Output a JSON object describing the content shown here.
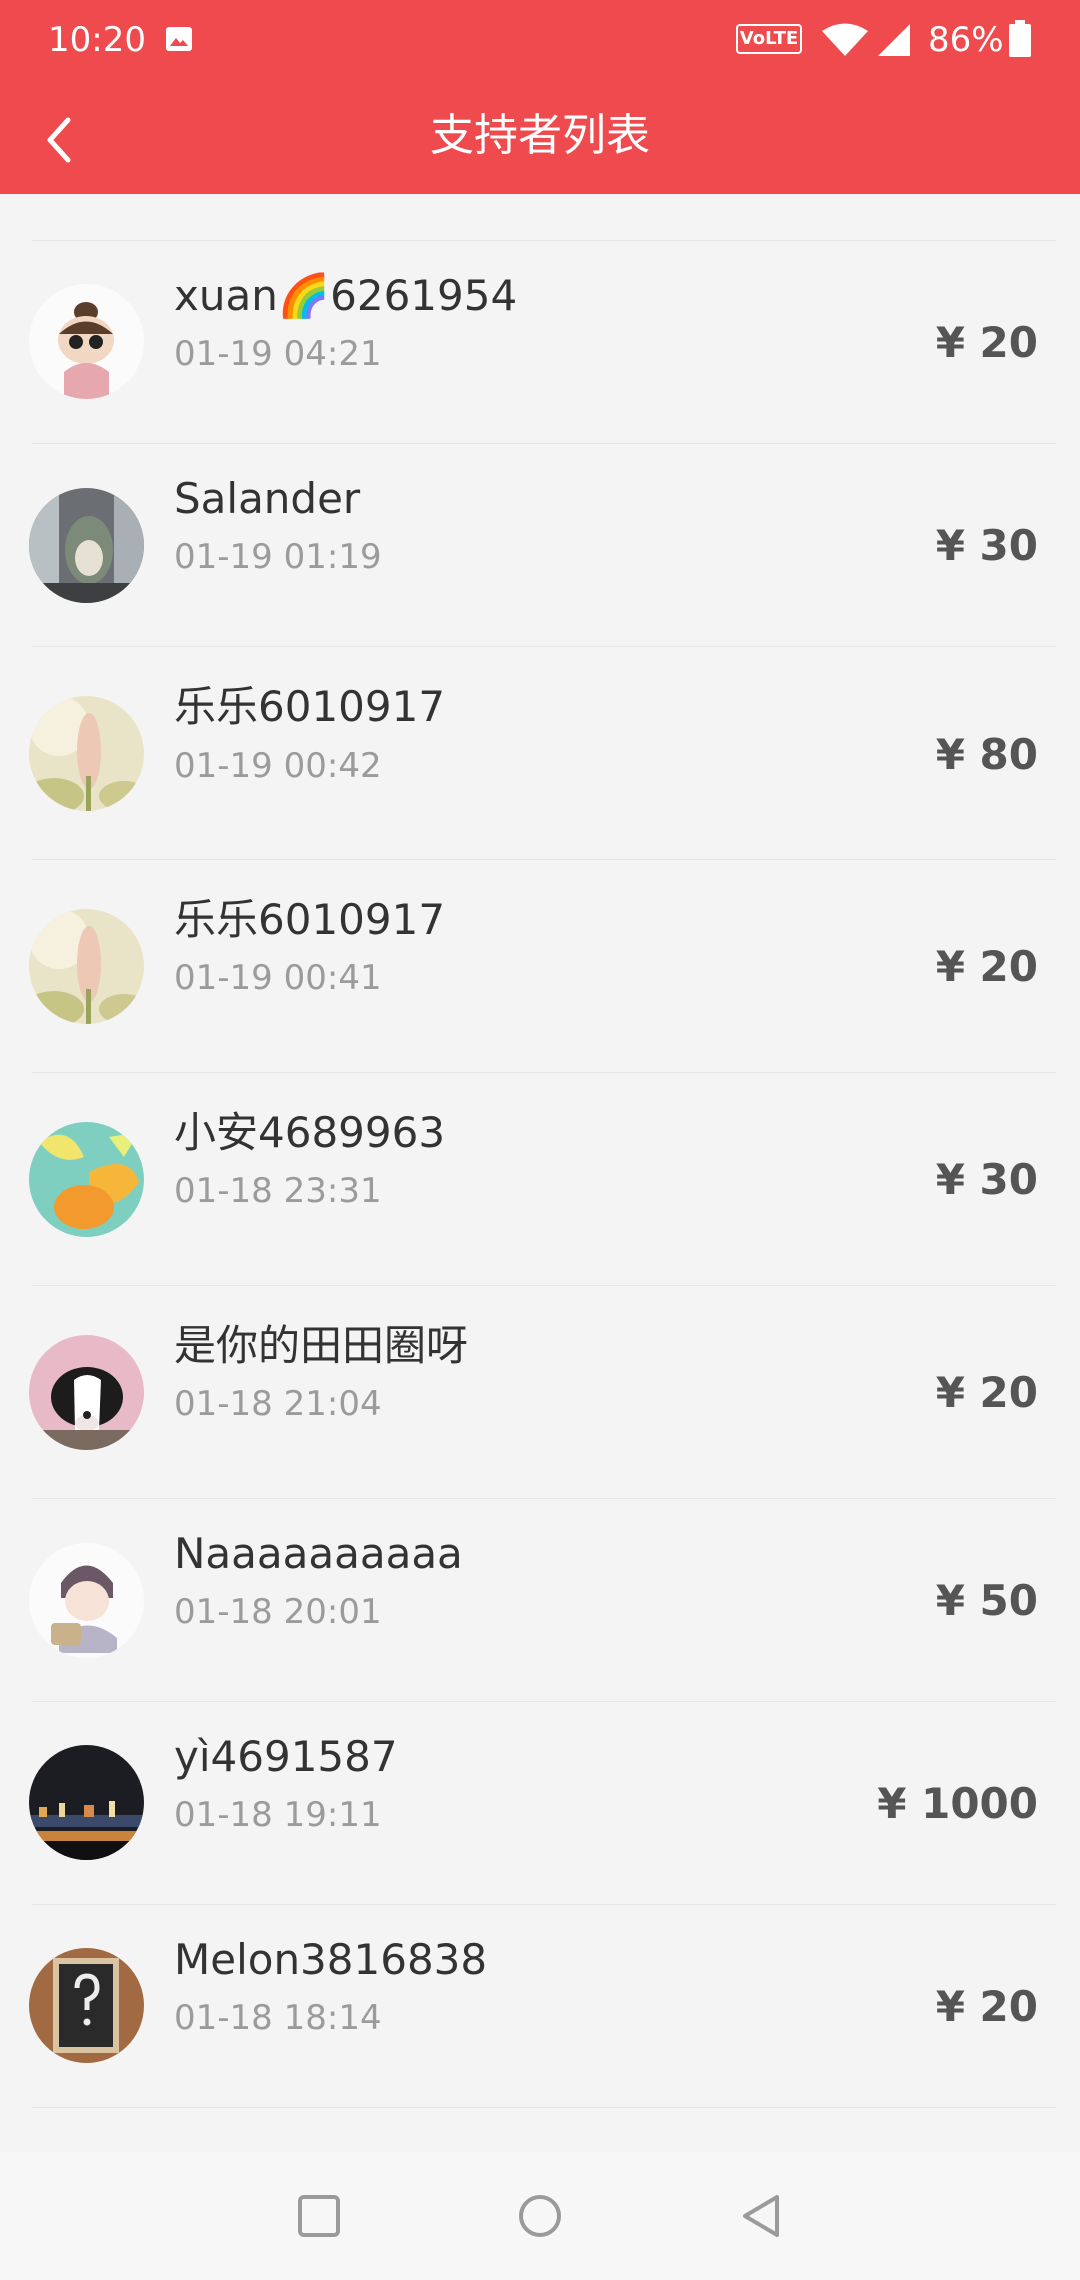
{
  "status_bar": {
    "time": "10:20",
    "volte": "VoLTE",
    "battery": "86%",
    "icons": [
      "gallery-icon",
      "wifi-icon",
      "signal-icon",
      "battery-icon"
    ]
  },
  "header": {
    "title": "支持者列表",
    "back_icon": "chevron-left-icon",
    "background": "#ef4b4e"
  },
  "supporters": [
    {
      "name": "xuan🌈6261954",
      "time": "01-19 04:21",
      "amount": "¥ 20"
    },
    {
      "name": "Salander",
      "time": "01-19 01:19",
      "amount": "¥ 30"
    },
    {
      "name": "乐乐6010917",
      "time": "01-19 00:42",
      "amount": "¥ 80"
    },
    {
      "name": "乐乐6010917",
      "time": "01-19 00:41",
      "amount": "¥ 20"
    },
    {
      "name": "小安4689963",
      "time": "01-18 23:31",
      "amount": "¥ 30"
    },
    {
      "name": "是你的田田圈呀",
      "time": "01-18 21:04",
      "amount": "¥ 20"
    },
    {
      "name": "Naaaaaaaaaa",
      "time": "01-18 20:01",
      "amount": "¥ 50"
    },
    {
      "name": "yì4691587",
      "time": "01-18 19:11",
      "amount": "¥ 1000"
    },
    {
      "name": "Melon3816838",
      "time": "01-18 18:14",
      "amount": "¥ 20"
    }
  ],
  "nav_bar": {
    "icons": [
      "recents-square-icon",
      "home-circle-icon",
      "back-triangle-icon"
    ]
  }
}
